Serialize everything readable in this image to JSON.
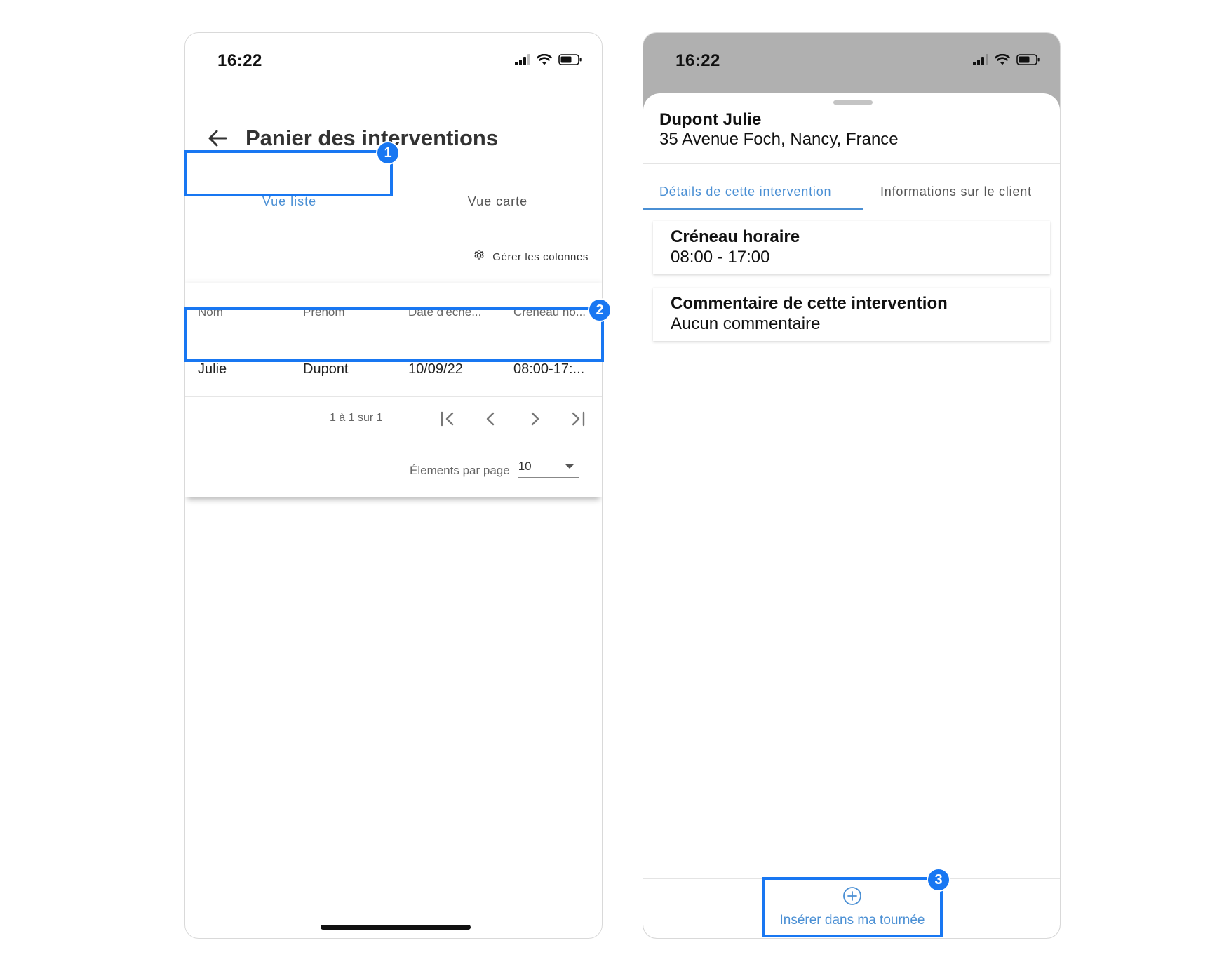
{
  "left_screen": {
    "status_time": "16:22",
    "title": "Panier des interventions",
    "tabs": [
      {
        "label": "Vue liste",
        "active": true
      },
      {
        "label": "Vue carte",
        "active": false
      }
    ],
    "manage_columns_label": "Gérer les colonnes",
    "table": {
      "headers": [
        "Nom",
        "Prénom",
        "Date d'éché...",
        "Créneau ho..."
      ],
      "rows": [
        [
          "Julie",
          "Dupont",
          "10/09/22",
          "08:00-17:..."
        ]
      ]
    },
    "pagination": {
      "range_label": "1 à 1 sur 1",
      "items_per_page_label": "Élements par page",
      "items_per_page_value": "10"
    }
  },
  "right_screen": {
    "status_time": "16:22",
    "client_name": "Dupont Julie",
    "client_address": "35 Avenue Foch, Nancy, France",
    "tabs": [
      {
        "label": "Détails de cette intervention",
        "active": true
      },
      {
        "label": "Informations sur le client",
        "active": false
      }
    ],
    "cards": [
      {
        "title": "Créneau horaire",
        "value": "08:00 - 17:00"
      },
      {
        "title": "Commentaire de cette intervention",
        "value": "Aucun commentaire"
      }
    ],
    "insert_button_label": "Insérer dans ma tournée"
  },
  "annotations": [
    {
      "number": "1",
      "target": "Vue liste tab"
    },
    {
      "number": "2",
      "target": "table row"
    },
    {
      "number": "3",
      "target": "insert button"
    }
  ],
  "colors": {
    "accent": "#4a8fd4",
    "highlight": "#1877f2",
    "sheet_backdrop": "#b0b0b0"
  },
  "icons": {
    "back": "arrow-left-icon",
    "manage_columns": "gear-icon",
    "first_page": "first-page-icon",
    "prev_page": "chevron-left-icon",
    "next_page": "chevron-right-icon",
    "last_page": "last-page-icon",
    "dropdown": "caret-down-icon",
    "insert": "plus-circle-icon"
  }
}
